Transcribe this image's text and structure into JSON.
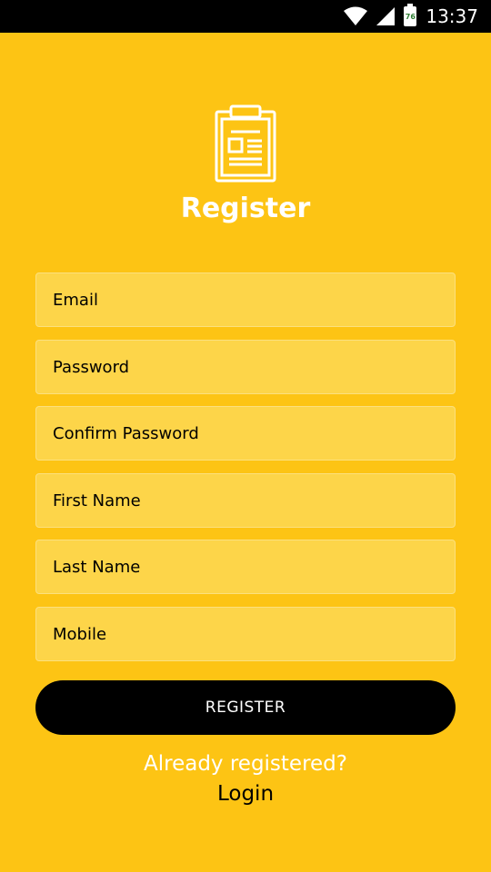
{
  "status_bar": {
    "battery_level": "76",
    "time": "13:37",
    "icons": [
      "wifi-icon",
      "signal-icon",
      "battery-icon"
    ]
  },
  "header": {
    "icon": "clipboard-icon",
    "title": "Register"
  },
  "form": {
    "email_placeholder": "Email",
    "password_placeholder": "Password",
    "confirm_password_placeholder": "Confirm Password",
    "first_name_placeholder": "First Name",
    "last_name_placeholder": "Last Name",
    "mobile_placeholder": "Mobile",
    "register_label": "REGISTER"
  },
  "footer": {
    "already_text": "Already registered?",
    "login_label": "Login"
  },
  "colors": {
    "background": "#FDC414",
    "field_bg": "#FDD549",
    "button_bg": "#000000",
    "accent_text": "#FFFFFF"
  }
}
